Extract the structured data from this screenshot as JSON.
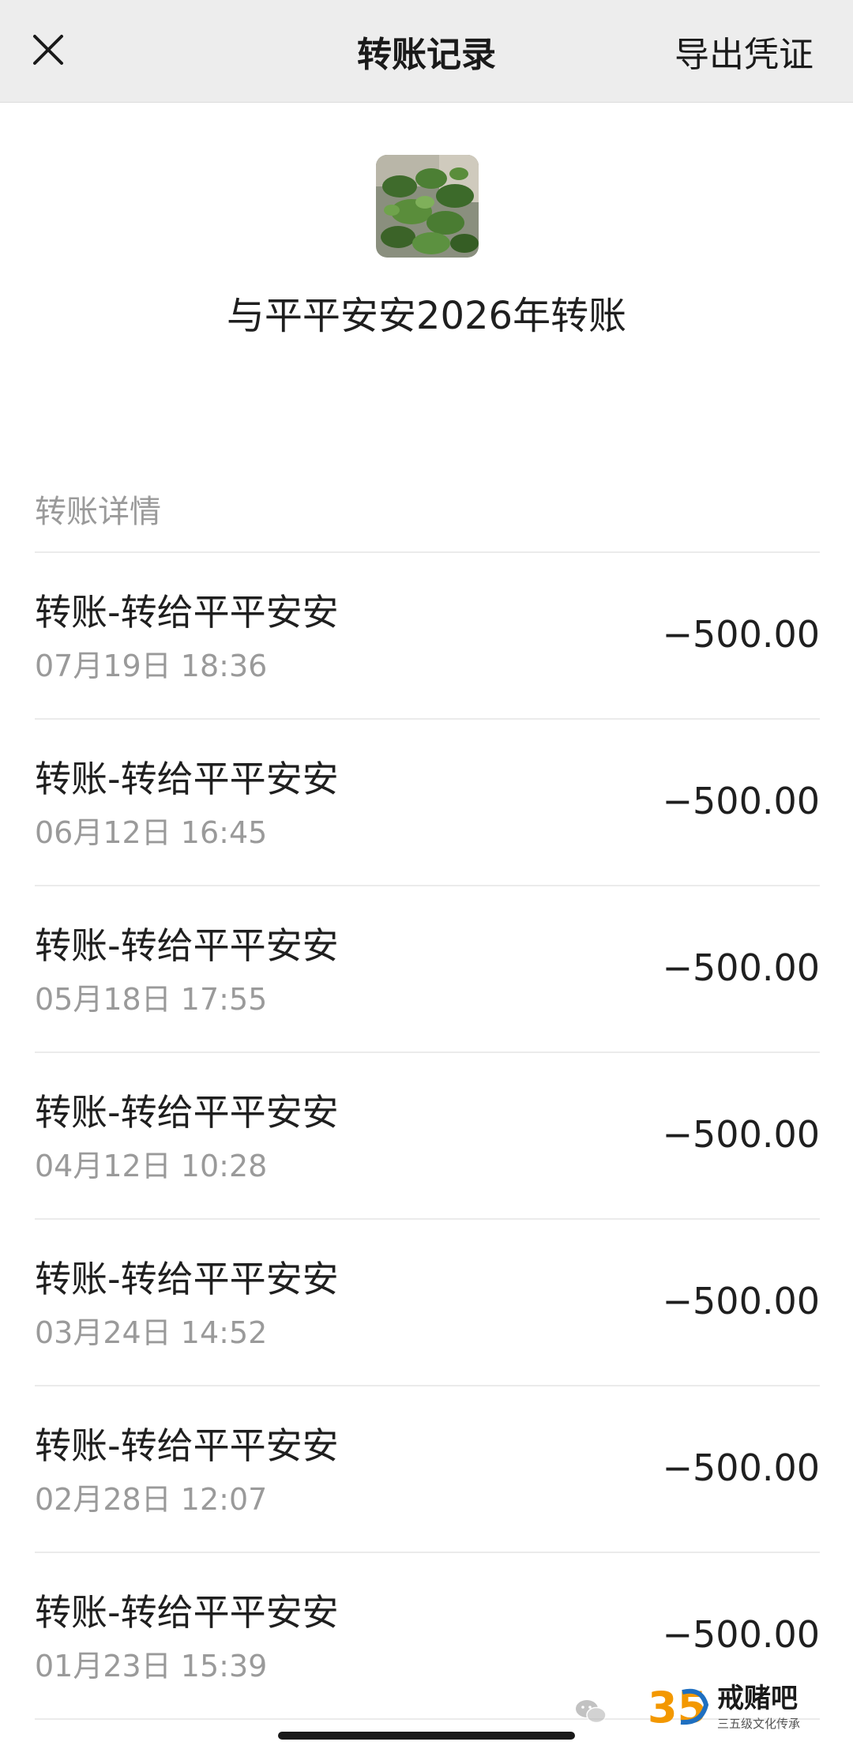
{
  "nav": {
    "title": "转账记录",
    "action": "导出凭证"
  },
  "header": {
    "title": "与平平安安2026年转账"
  },
  "section": {
    "label": "转账详情"
  },
  "records": [
    {
      "title": "转账-转给平平安安",
      "time": "07月19日 18:36",
      "amount": "−500.00"
    },
    {
      "title": "转账-转给平平安安",
      "time": "06月12日 16:45",
      "amount": "−500.00"
    },
    {
      "title": "转账-转给平平安安",
      "time": "05月18日 17:55",
      "amount": "−500.00"
    },
    {
      "title": "转账-转给平平安安",
      "time": "04月12日 10:28",
      "amount": "−500.00"
    },
    {
      "title": "转账-转给平平安安",
      "time": "03月24日 14:52",
      "amount": "−500.00"
    },
    {
      "title": "转账-转给平平安安",
      "time": "02月28日 12:07",
      "amount": "−500.00"
    },
    {
      "title": "转账-转给平平安安",
      "time": "01月23日 15:39",
      "amount": "−500.00"
    }
  ],
  "watermark": {
    "name": "戒赌吧",
    "subtitle": "三五级文化传承",
    "logo_text": "35"
  },
  "colors": {
    "navbar_bg": "#ededed",
    "text_primary": "#1f1f1f",
    "text_secondary": "#9a9a9a",
    "divider": "#ebebeb",
    "logo_orange": "#f39800",
    "logo_blue": "#1f6fc0"
  },
  "icons": {
    "close": "close-icon",
    "avatar": "plant-avatar",
    "wechat": "wechat-icon"
  }
}
